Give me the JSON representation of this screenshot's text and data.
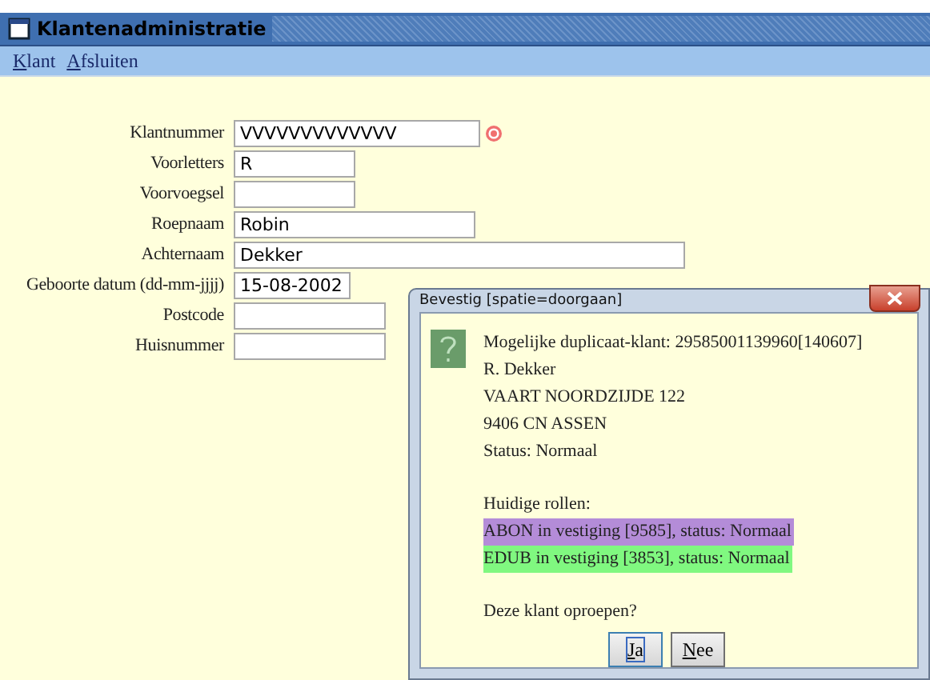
{
  "window": {
    "title": "Klantenadministratie"
  },
  "menu": [
    {
      "accel": "K",
      "rest": "lant"
    },
    {
      "accel": "A",
      "rest": "fsluiten"
    }
  ],
  "fields": [
    {
      "label": "Klantnummer",
      "value": "VVVVVVVVVVVVV",
      "required": true
    },
    {
      "label": "Voorletters",
      "value": "R",
      "required": false
    },
    {
      "label": "Voorvoegsel",
      "required": false
    },
    {
      "label": "Roepnaam",
      "value": "Robin",
      "required": false
    },
    {
      "label": "Achternaam",
      "value": "Dekker",
      "required": false
    },
    {
      "label": "Geboorte datum (dd-mm-jjjj)",
      "value": "15-08-2002",
      "required": false
    },
    {
      "label": "Postcode",
      "required": false
    },
    {
      "label": "Huisnummer",
      "required": false
    }
  ],
  "dialog": {
    "title": "Bevestig [spatie=doorgaan]",
    "details": [
      "Mogelijke duplicaat-klant: 29585001139960[140607]",
      "R. Dekker",
      "VAART NOORDZIJDE 122",
      "9406 CN ASSEN",
      "Status: Normaal"
    ],
    "roles_heading": "Huidige rollen:",
    "roles": [
      {
        "text": "ABON in vestiging [9585], status: Normaal",
        "color": "#b48cd8"
      },
      {
        "text": "EDUB in vestiging [3853], status: Normaal",
        "color": "#80f880"
      }
    ],
    "question": "Deze klant oproepen?",
    "buttons": [
      {
        "accel": "J",
        "rest": "a",
        "selected": true
      },
      {
        "accel": "N",
        "rest": "ee",
        "selected": false
      }
    ]
  }
}
